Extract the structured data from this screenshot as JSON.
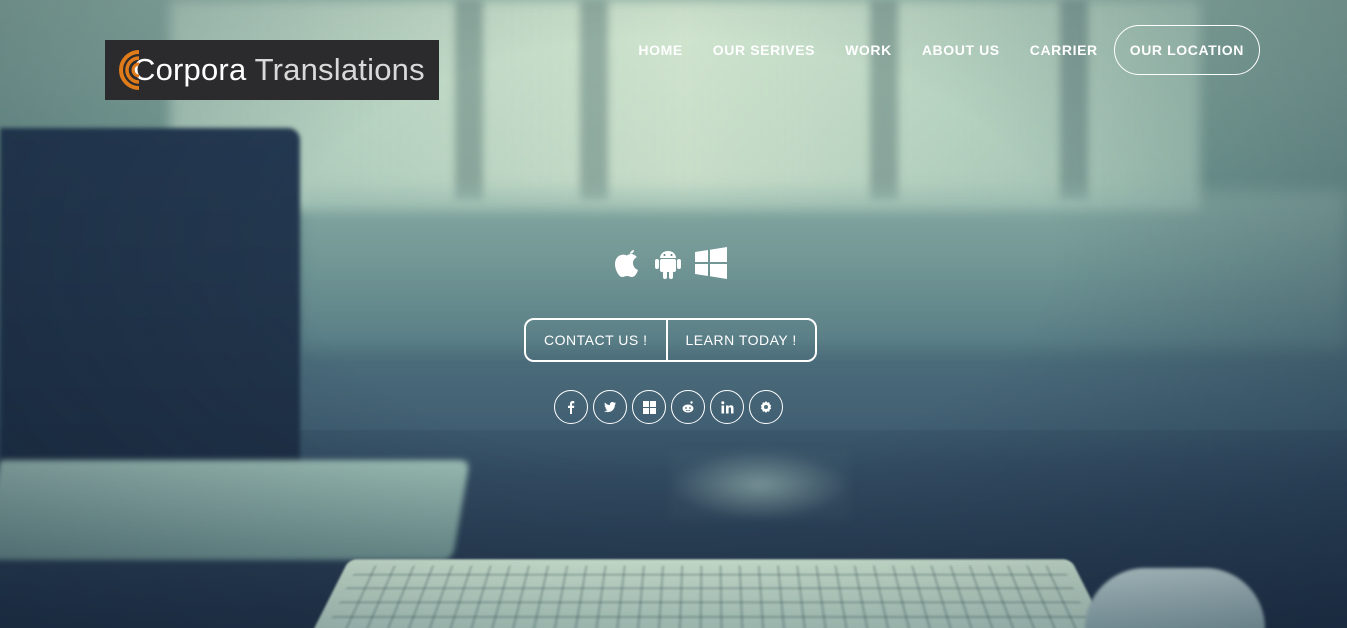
{
  "logo": {
    "brand_bold": "Corpora",
    "brand_light": "Translations",
    "accent_color": "#e07b1a"
  },
  "nav": {
    "items": [
      "HOME",
      "OUR SERIVES",
      "WORK",
      "ABOUT US",
      "CARRIER"
    ],
    "cta_label": "OUR LOCATION"
  },
  "platforms": [
    "apple-icon",
    "android-icon",
    "windows-icon"
  ],
  "cta": {
    "contact_label": "CONTACT US !",
    "learn_label": "LEARN TODAY !"
  },
  "social": [
    "facebook-icon",
    "twitter-icon",
    "windows-icon",
    "reddit-icon",
    "linkedin-icon",
    "settings-icon"
  ]
}
